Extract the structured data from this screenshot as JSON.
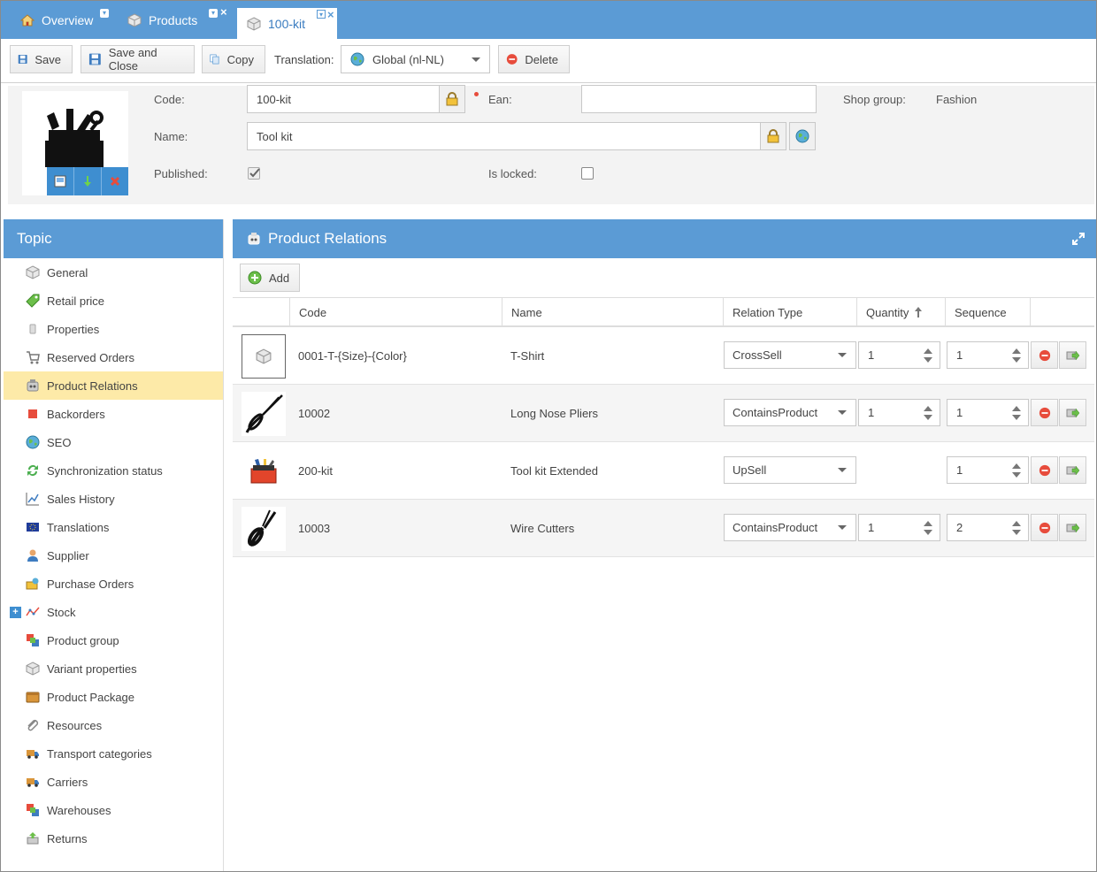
{
  "tabs": [
    {
      "label": "Overview",
      "icon": "home-icon"
    },
    {
      "label": "Products",
      "icon": "cube-icon"
    },
    {
      "label": "100-kit",
      "icon": "cube-icon",
      "active": true
    }
  ],
  "toolbar": {
    "save_label": "Save",
    "save_close_label": "Save and Close",
    "copy_label": "Copy",
    "translation_label": "Translation:",
    "translation_value": "Global (nl-NL)",
    "delete_label": "Delete"
  },
  "product": {
    "code_label": "Code:",
    "code_value": "100-kit",
    "ean_label": "Ean:",
    "ean_value": "",
    "shop_group_label": "Shop group:",
    "shop_group_value": "Fashion",
    "name_label": "Name:",
    "name_value": "Tool kit",
    "published_label": "Published:",
    "published": true,
    "locked_label": "Is locked:",
    "locked": false
  },
  "topic": {
    "title": "Topic",
    "items": [
      {
        "label": "General",
        "icon": "cube-icon"
      },
      {
        "label": "Retail price",
        "icon": "price-tag-icon"
      },
      {
        "label": "Properties",
        "icon": "properties-icon"
      },
      {
        "label": "Reserved Orders",
        "icon": "cart-icon"
      },
      {
        "label": "Product Relations",
        "icon": "relations-icon",
        "selected": true
      },
      {
        "label": "Backorders",
        "icon": "backorder-icon"
      },
      {
        "label": "SEO",
        "icon": "globe-icon"
      },
      {
        "label": "Synchronization status",
        "icon": "sync-icon"
      },
      {
        "label": "Sales History",
        "icon": "chart-icon"
      },
      {
        "label": "Translations",
        "icon": "flag-icon"
      },
      {
        "label": "Supplier",
        "icon": "person-icon"
      },
      {
        "label": "Purchase Orders",
        "icon": "purchase-icon"
      },
      {
        "label": "Stock",
        "icon": "stock-icon",
        "expandable": true
      },
      {
        "label": "Product group",
        "icon": "group-icon"
      },
      {
        "label": "Variant properties",
        "icon": "variant-icon"
      },
      {
        "label": "Product Package",
        "icon": "package-icon"
      },
      {
        "label": "Resources",
        "icon": "paperclip-icon"
      },
      {
        "label": "Transport categories",
        "icon": "truck-icon"
      },
      {
        "label": "Carriers",
        "icon": "truck-icon"
      },
      {
        "label": "Warehouses",
        "icon": "warehouse-icon"
      },
      {
        "label": "Returns",
        "icon": "return-icon"
      }
    ]
  },
  "relations": {
    "title": "Product Relations",
    "add_label": "Add",
    "columns": {
      "code": "Code",
      "name": "Name",
      "relation_type": "Relation Type",
      "quantity": "Quantity",
      "sequence": "Sequence"
    },
    "rows": [
      {
        "code": "0001-T-{Size}-{Color}",
        "name": "T-Shirt",
        "relation_type": "CrossSell",
        "quantity": "1",
        "sequence": "1",
        "image": "placeholder-cube-icon"
      },
      {
        "code": "10002",
        "name": "Long Nose Pliers",
        "relation_type": "ContainsProduct",
        "quantity": "1",
        "sequence": "1",
        "image": "pliers-icon"
      },
      {
        "code": "200-kit",
        "name": "Tool kit Extended",
        "relation_type": "UpSell",
        "quantity": "",
        "sequence": "1",
        "image": "toolbox-icon"
      },
      {
        "code": "10003",
        "name": "Wire Cutters",
        "relation_type": "ContainsProduct",
        "quantity": "1",
        "sequence": "2",
        "image": "cutters-icon"
      }
    ]
  },
  "colors": {
    "header_blue": "#5b9bd5",
    "selected_row": "#fdeaa8"
  }
}
